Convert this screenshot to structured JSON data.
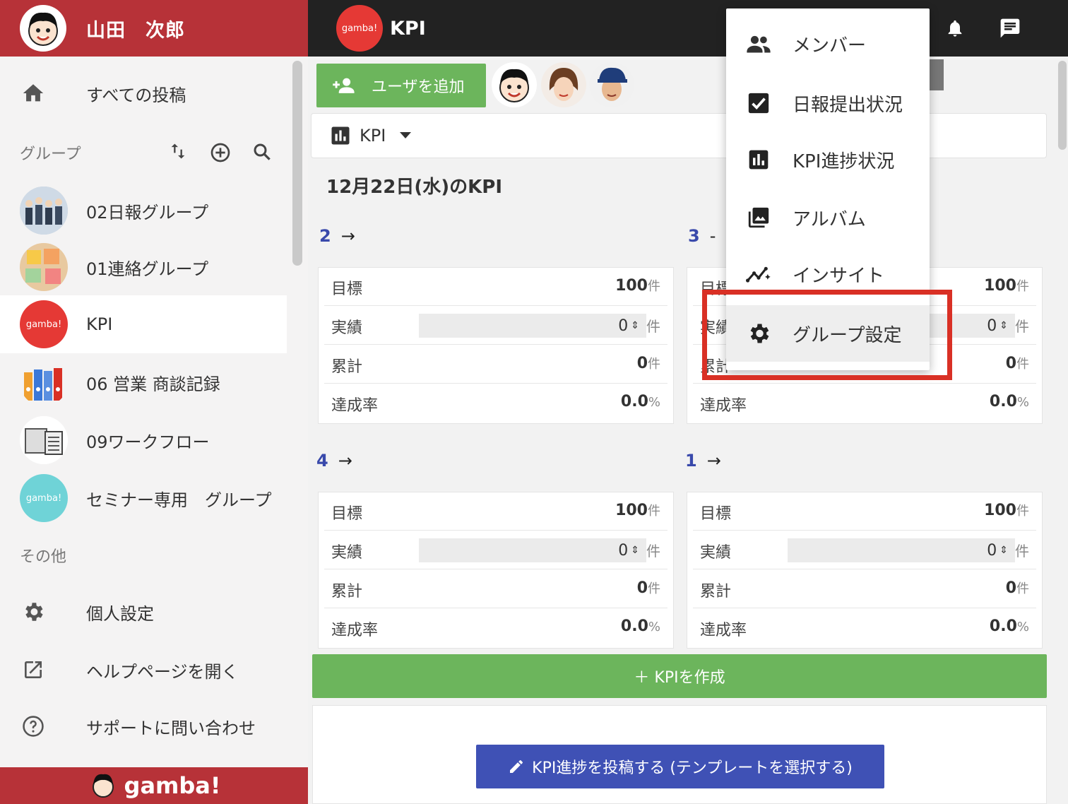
{
  "header": {
    "user_name": "山田　次郎",
    "group_title": "KPI",
    "group_logo_text": "gamba!"
  },
  "sidebar": {
    "all_posts": "すべての投稿",
    "groups_heading": "グループ",
    "groups": [
      {
        "label": "02日報グループ"
      },
      {
        "label": "01連絡グループ"
      },
      {
        "label": "KPI",
        "logo_text": "gamba!"
      },
      {
        "label": "06 営業 商談記録"
      },
      {
        "label": "09ワークフロー"
      },
      {
        "label": "セミナー専用　グループ",
        "logo_text": "gamba!"
      }
    ],
    "other_heading": "その他",
    "personal_settings": "個人設定",
    "help_page": "ヘルプページを開く",
    "support": "サポートに問い合わせ",
    "brand": "gamba!"
  },
  "main": {
    "add_user_label": "ユーザを追加",
    "kpi_selector": "KPI",
    "date_title": "12月22日(水)のKPI",
    "kpis": [
      {
        "num": "2",
        "arrow": "→",
        "target": "100",
        "actual": "0",
        "cumulative": "0",
        "rate": "0.0"
      },
      {
        "num": "3",
        "arrow": "-",
        "target": "100",
        "actual": "0",
        "cumulative": "0",
        "rate": "0.0"
      },
      {
        "num": "4",
        "arrow": "→",
        "target": "100",
        "actual": "0",
        "cumulative": "0",
        "rate": "0.0"
      },
      {
        "num": "1",
        "arrow": "→",
        "target": "100",
        "actual": "0",
        "cumulative": "0",
        "rate": "0.0"
      }
    ],
    "labels": {
      "target": "目標",
      "actual": "実績",
      "cumulative": "累計",
      "rate": "達成率",
      "unit": "件",
      "percent": "%"
    },
    "create_kpi": "＋ KPIを作成",
    "post_kpi": "KPI進捗を投稿する (テンプレートを選択する)"
  },
  "menu": {
    "items": [
      {
        "label": "メンバー",
        "icon": "people-icon"
      },
      {
        "label": "日報提出状況",
        "icon": "checkbox-icon"
      },
      {
        "label": "KPI進捗状況",
        "icon": "bar-chart-icon"
      },
      {
        "label": "アルバム",
        "icon": "photo-library-icon"
      },
      {
        "label": "インサイト",
        "icon": "insights-icon"
      },
      {
        "label": "グループ設定",
        "icon": "gear-icon"
      }
    ]
  },
  "colors": {
    "user_bar": "#b73238",
    "top_bar": "#222222",
    "green": "#6cb55c",
    "indigo": "#3f51b5",
    "highlight": "#d93025"
  }
}
